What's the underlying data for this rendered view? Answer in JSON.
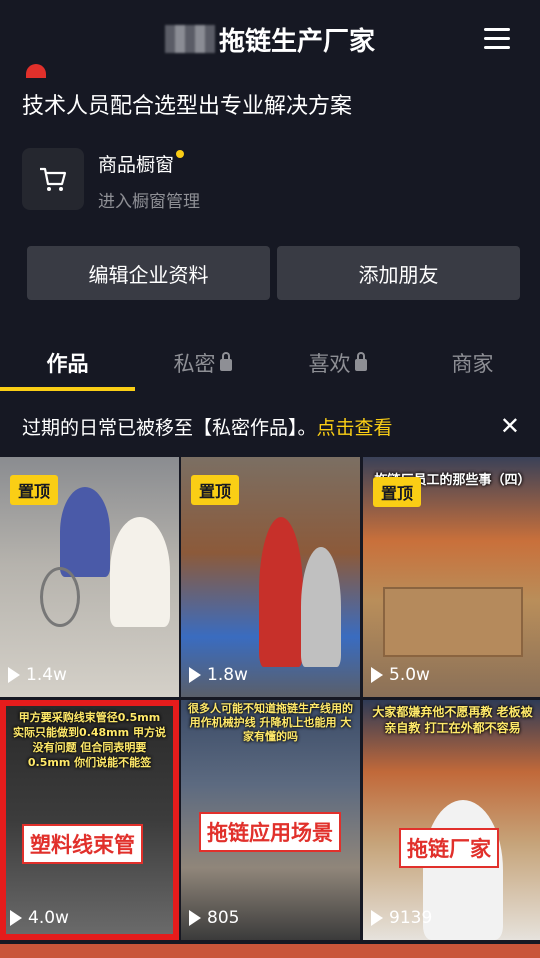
{
  "header": {
    "title": "拖链生产厂家"
  },
  "profile": {
    "description": "技术人员配合选型出专业解决方案"
  },
  "shop": {
    "title": "商品橱窗",
    "subtitle": "进入橱窗管理"
  },
  "buttons": {
    "edit": "编辑企业资料",
    "add_friend": "添加朋友"
  },
  "tabs": [
    {
      "label": "作品"
    },
    {
      "label": "私密"
    },
    {
      "label": "喜欢"
    },
    {
      "label": "商家"
    }
  ],
  "notice": {
    "text": "过期的日常已被移至【私密作品】。",
    "link": "点击查看"
  },
  "videos": [
    {
      "pinned": "置顶",
      "views": "1.4w"
    },
    {
      "pinned": "置顶",
      "views": "1.8w"
    },
    {
      "pinned": "置顶",
      "views": "5.0w",
      "caption": "拖链厂员工的那些事（四）"
    },
    {
      "views": "4.0w",
      "caption": "甲方要采购线束管径0.5mm 实际只能做到0.48mm 甲方说没有问题 但合同表明要0.5mm 你们说能不能签",
      "tag": "塑料线束管"
    },
    {
      "views": "805",
      "caption": "很多人可能不知道拖链生产线用的 用作机械护线 升降机上也能用 大家有懂的吗",
      "tag": "拖链应用场景"
    },
    {
      "views": "9139",
      "caption": "大家都嫌弃他不愿再教 老板被亲自教 打工在外都不容易",
      "tag": "拖链厂家"
    }
  ],
  "colors": {
    "accent": "#face15",
    "background": "#161823",
    "button": "#393b44",
    "red": "#e1302b"
  }
}
